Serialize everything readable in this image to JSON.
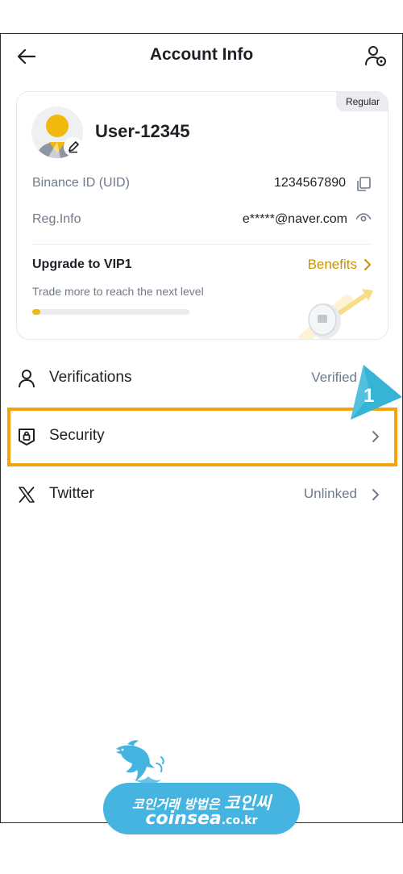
{
  "header": {
    "title": "Account Info",
    "back_icon": "arrow-left-icon",
    "profile_icon": "user-settings-icon"
  },
  "account_card": {
    "tier_badge": "Regular",
    "username": "User-12345",
    "uid_label": "Binance ID (UID)",
    "uid_value": "1234567890",
    "reg_label": "Reg.Info",
    "reg_value": "e*****@naver.com",
    "vip_title": "Upgrade to VIP1",
    "vip_benefits": "Benefits",
    "vip_subtitle": "Trade more to reach the next level",
    "vip_progress": 0.05
  },
  "menu": [
    {
      "label": "Verifications",
      "status": "Verified",
      "icon": "person-icon"
    },
    {
      "label": "Security",
      "status": "",
      "icon": "shield-lock-icon"
    },
    {
      "label": "Twitter",
      "status": "Unlinked",
      "icon": "x-logo-icon"
    }
  ],
  "annotation": {
    "step_number": "1"
  },
  "watermark": {
    "line1_prefix": "코인거래 방법은",
    "line1_brand": "코인씨",
    "line2_domain": "coinsea",
    "line2_tld": ".co.kr"
  },
  "colors": {
    "accent_yellow": "#F0B90B",
    "benefits_gold": "#C99400",
    "highlight_orange": "#F7A20C",
    "pointer_teal": "#35B4D6",
    "text_primary": "#1E2026",
    "text_secondary": "#707A8A"
  }
}
